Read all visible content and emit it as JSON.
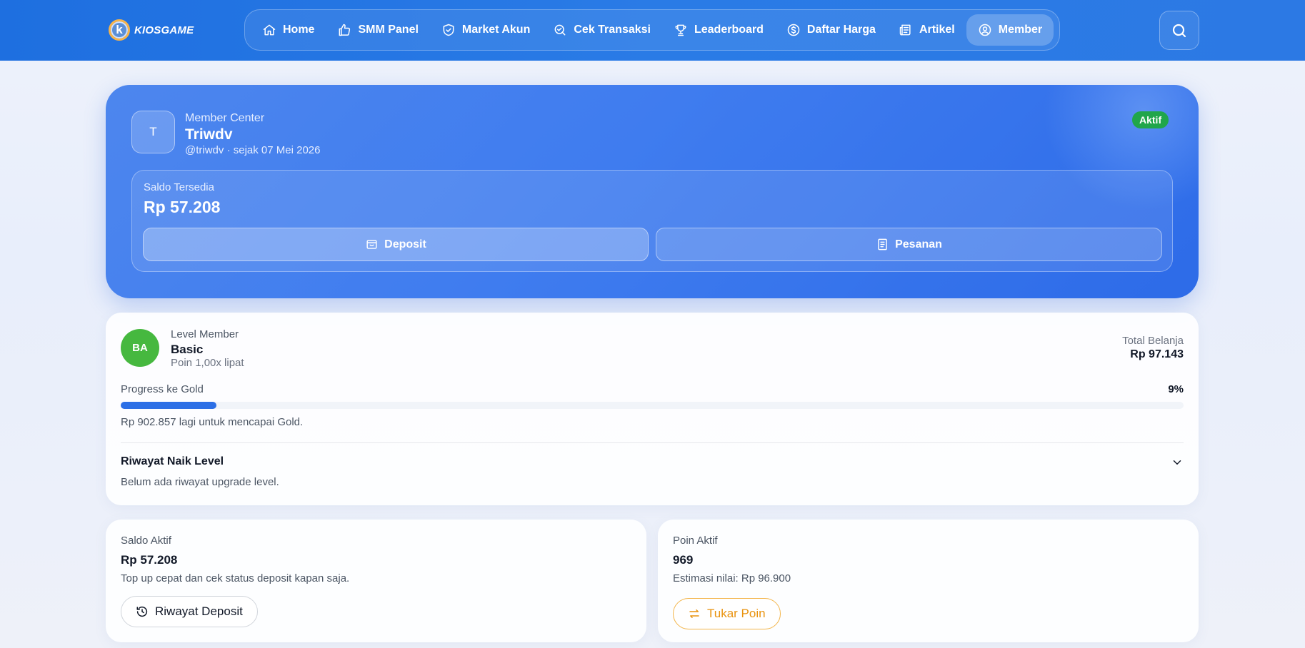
{
  "brand": {
    "logo_letter": "k",
    "name": "KIOSGAME"
  },
  "nav": {
    "items": [
      {
        "label": "Home",
        "icon": "home-icon"
      },
      {
        "label": "SMM Panel",
        "icon": "thumbs-up-icon"
      },
      {
        "label": "Market Akun",
        "icon": "shield-check-icon"
      },
      {
        "label": "Cek Transaksi",
        "icon": "search-check-icon"
      },
      {
        "label": "Leaderboard",
        "icon": "trophy-icon"
      },
      {
        "label": "Daftar Harga",
        "icon": "dollar-circle-icon"
      },
      {
        "label": "Artikel",
        "icon": "newspaper-icon"
      },
      {
        "label": "Member",
        "icon": "user-circle-icon",
        "active": true
      }
    ],
    "search_icon": "search-icon"
  },
  "hero": {
    "avatar_initial": "T",
    "section_label": "Member Center",
    "name": "Triwdv",
    "meta": "@triwdv · sejak 07 Mei 2026",
    "status": "Aktif",
    "balance_label": "Saldo Tersedia",
    "balance_value": "Rp 57.208",
    "deposit_label": "Deposit",
    "orders_label": "Pesanan"
  },
  "level": {
    "avatar_initials": "BA",
    "label": "Level Member",
    "name": "Basic",
    "multiplier": "Poin 1,00x lipat",
    "total_label": "Total Belanja",
    "total_value": "Rp 97.143",
    "progress_label": "Progress ke Gold",
    "progress_percent_text": "9%",
    "progress_value": 0.09,
    "progress_note": "Rp 902.857 lagi untuk mencapai Gold.",
    "history_title": "Riwayat Naik Level",
    "history_empty": "Belum ada riwayat upgrade level."
  },
  "saldo_card": {
    "label": "Saldo Aktif",
    "value": "Rp 57.208",
    "note": "Top up cepat dan cek status deposit kapan saja.",
    "button_label": "Riwayat Deposit"
  },
  "poin_card": {
    "label": "Poin Aktif",
    "value": "969",
    "note": "Estimasi nilai: Rp 96.900",
    "button_label": "Tukar Poin"
  },
  "colors": {
    "topbar": "#1e6fe0",
    "hero": "#3f7cef",
    "status_badge": "#20a64a",
    "level_avatar": "#46b83f",
    "progress_fill": "#2c6fe6",
    "tukar_accent": "#e9930f"
  }
}
